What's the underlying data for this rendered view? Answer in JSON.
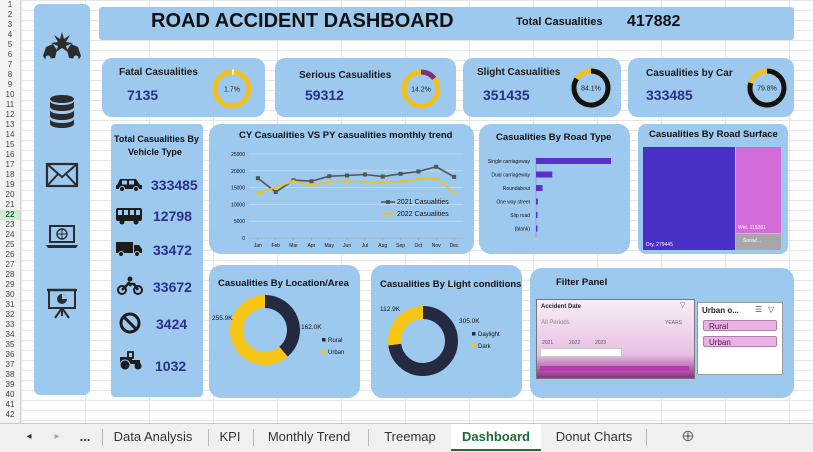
{
  "dashboard": {
    "title": "ROAD ACCIDENT DASHBOARD",
    "total_label": "Total Casualities",
    "total_value": "417882"
  },
  "kpis": [
    {
      "label": "Fatal Casualities",
      "value": "7135",
      "pct_label": "1.7%",
      "pct": 1.7,
      "ring_color": "#f2c21a",
      "fill_color": "#ffffff"
    },
    {
      "label": "Serious Casualities",
      "value": "59312",
      "pct_label": "14.2%",
      "pct": 14.2,
      "ring_color": "#f2c21a",
      "fill_color": "#7a2f84"
    },
    {
      "label": "Slight Casualities",
      "value": "351435",
      "pct_label": "84.1%",
      "pct": 84.1,
      "ring_color": "#f2c21a",
      "fill_color": "#111111"
    },
    {
      "label": "Casualities by Car",
      "value": "333485",
      "pct_label": "79.8%",
      "pct": 79.8,
      "ring_color": "#f2c21a",
      "fill_color": "#111111"
    }
  ],
  "vehicle_panel": {
    "title_line1": "Total Casualities By",
    "title_line2": "Vehicle Type",
    "items": [
      {
        "icon": "car-icon",
        "value": "333485"
      },
      {
        "icon": "bus-icon",
        "value": "12798"
      },
      {
        "icon": "truck-icon",
        "value": "33472"
      },
      {
        "icon": "motorcycle-icon",
        "value": "33672"
      },
      {
        "icon": "no-entry-icon",
        "value": "3424"
      },
      {
        "icon": "tractor-icon",
        "value": "1032"
      }
    ]
  },
  "trend_chart": {
    "title": "CY Casualities VS PY casualities monthly trend",
    "legend_2021": "2021 Casualities",
    "legend_2022": "2022 Casualities"
  },
  "road_type": {
    "title": "Casualities By Road Type"
  },
  "road_surface": {
    "title": "Casualities By Road Surface",
    "dry_label": "Dry, 279445",
    "wet_label": "Wet, 115261",
    "snow_label": "Snow/..."
  },
  "location": {
    "title": "Casualities By Location/Area"
  },
  "light": {
    "title": "Casualities By Light conditions"
  },
  "filter_panel": {
    "title": "Filter Panel",
    "timeline_title": "Accident Date",
    "all_periods": "All Periods",
    "years_label": "YEARS",
    "years": [
      "2021",
      "2022",
      "2023"
    ],
    "slicer_title": "Urban o...",
    "slicer_items": [
      "Rural",
      "Urban"
    ]
  },
  "chart_data": [
    {
      "type": "line",
      "title": "CY Casualities VS PY casualities monthly trend",
      "categories": [
        "Jan",
        "Feb",
        "Mar",
        "Apr",
        "May",
        "Jun",
        "Jul",
        "Aug",
        "Sep",
        "Oct",
        "Nov",
        "Dec"
      ],
      "ylim": [
        0,
        25000
      ],
      "yticks": [
        0,
        5000,
        10000,
        15000,
        20000,
        25000
      ],
      "series": [
        {
          "name": "2021 Casualities",
          "color": "#555555",
          "values": [
            17800,
            13700,
            17200,
            16900,
            18400,
            18600,
            18900,
            18300,
            19100,
            19800,
            21200,
            18200
          ]
        },
        {
          "name": "2022 Casualities",
          "color": "#f2c21a",
          "values": [
            13300,
            15100,
            16900,
            15800,
            16700,
            16900,
            16700,
            16400,
            16800,
            17600,
            17800,
            13500
          ]
        }
      ]
    },
    {
      "type": "bar",
      "title": "Casualities By Road Type",
      "categories": [
        "Single carriageway",
        "Dual carriageway",
        "Roundabout",
        "One way street",
        "Slip road",
        "(blank)"
      ],
      "values": [
        309698,
        67373,
        26828,
        7389,
        4594,
        2000
      ],
      "color": "#5b2fc9"
    },
    {
      "type": "heatmap",
      "title": "Casualities By Road Surface",
      "categories": [
        "Dry",
        "Wet",
        "Snow/..."
      ],
      "values": [
        279445,
        115261,
        23176
      ],
      "colors": [
        "#4a2fc6",
        "#d36bd8",
        "#a7a7a7"
      ]
    },
    {
      "type": "pie",
      "title": "Casualities By Location/Area",
      "categories": [
        "Rural",
        "Urban"
      ],
      "values": [
        162000,
        255900
      ],
      "labels": [
        "162.0K",
        "255.9K"
      ],
      "colors": [
        "#262a40",
        "#f7c515"
      ]
    },
    {
      "type": "pie",
      "title": "Casualities By Light conditions",
      "categories": [
        "Daylight",
        "Dark"
      ],
      "values": [
        305000,
        112900
      ],
      "labels": [
        "305.0K",
        "112.9K"
      ],
      "colors": [
        "#262a40",
        "#f7c515"
      ]
    }
  ],
  "sheet_tabs": [
    "Data Analysis",
    "KPI",
    "Monthly Trend",
    "Treemap",
    "Dashboard",
    "Donut Charts"
  ],
  "active_tab": "Dashboard"
}
